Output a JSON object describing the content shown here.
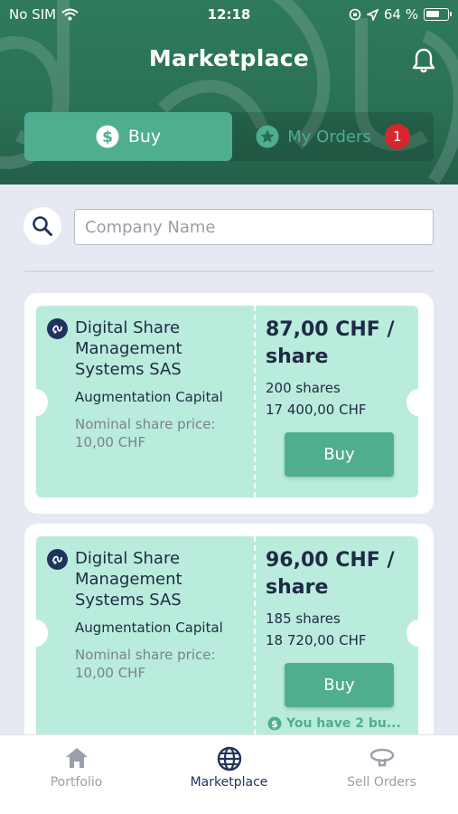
{
  "status_bar": {
    "carrier": "No SIM",
    "time": "12:18",
    "battery": "64 %",
    "battery_level": 0.64
  },
  "header": {
    "title": "Marketplace"
  },
  "tabs": {
    "buy_label": "Buy",
    "orders_label": "My Orders",
    "orders_badge": "1",
    "selected": "Buy"
  },
  "search": {
    "placeholder": "Company Name",
    "value": ""
  },
  "listings": [
    {
      "company": "Digital Share Management Systems SAS",
      "fund": "Augmentation Capital",
      "nominal": "Nominal share price: 10,00 CHF",
      "price": "87,00 CHF / share",
      "shares": "200 shares",
      "total": "17 400,00 CHF",
      "buy_label": "Buy"
    },
    {
      "company": "Digital Share Management Systems SAS",
      "fund": "Augmentation Capital",
      "nominal": "Nominal share price: 10,00 CHF",
      "price": "96,00 CHF / share",
      "shares": "185 shares",
      "total": "18 720,00 CHF",
      "buy_label": "Buy",
      "note": "You have 2 bu..."
    }
  ],
  "nav": {
    "portfolio": "Portfolio",
    "marketplace": "Marketplace",
    "sell_orders": "Sell Orders",
    "active": "Marketplace"
  },
  "colors": {
    "header": "#2a7055",
    "accent": "#4fae90",
    "ticket": "#b9ecdc",
    "navy": "#20335c",
    "badge": "#d7262e"
  },
  "icons": {
    "bell": "bell-icon",
    "buy_tab": "dollar-circle-icon",
    "orders_tab": "star-circle-icon",
    "search": "search-icon",
    "company_logo": "company-logo-icon",
    "portfolio": "home-icon",
    "marketplace": "globe-icon",
    "sell_orders": "sell-orders-icon"
  }
}
